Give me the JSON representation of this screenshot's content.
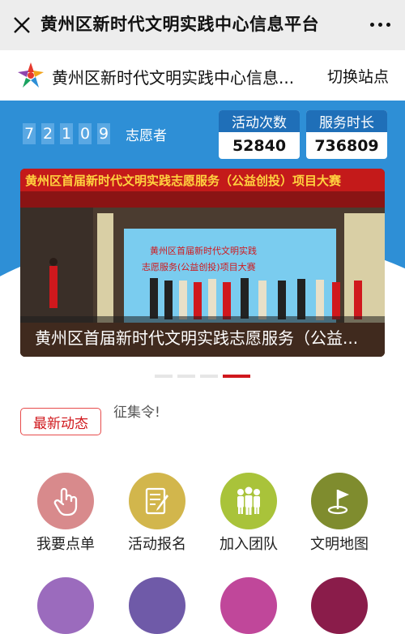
{
  "topbar": {
    "title": "黄州区新时代文明实践中心信息平台",
    "close_icon": "close-icon",
    "more_icon": "more-icon"
  },
  "site": {
    "name": "黄州区新时代文明实践中心信息...",
    "switch_label": "切换站点"
  },
  "volunteers": {
    "digits": [
      "7",
      "2",
      "1",
      "0",
      "9"
    ],
    "label": "志愿者"
  },
  "stats": [
    {
      "title": "活动次数",
      "value": "52840"
    },
    {
      "title": "服务时长",
      "value": "736809"
    }
  ],
  "banner": {
    "caption": "黄州区首届新时代文明实践志愿服务（公益...",
    "slide_sign": "黄州区首届新时代文明实践志愿服务（公益创投）项目大赛",
    "screen_text_1": "黄州区首届新时代文明实践",
    "screen_text_2": "志愿服务(公益创投)项目大赛",
    "slides_total": 4,
    "active_slide": 4
  },
  "news": {
    "tag": "最新动态",
    "text": "征集令!"
  },
  "menu": [
    {
      "label": "我要点单",
      "icon": "hand-pointer-icon",
      "color": "#d88a8c"
    },
    {
      "label": "活动报名",
      "icon": "sign-up-form-icon",
      "color": "#d2b64c"
    },
    {
      "label": "加入团队",
      "icon": "team-icon",
      "color": "#a9c33a"
    },
    {
      "label": "文明地图",
      "icon": "map-flag-icon",
      "color": "#7f8c2e"
    }
  ],
  "menu_row2_colors": [
    "#9b6bbd",
    "#6f5aa8",
    "#c0479a",
    "#8a1c4a"
  ],
  "colors": {
    "hero_blue": "#2e8fd6",
    "accent_red": "#d0181d"
  }
}
